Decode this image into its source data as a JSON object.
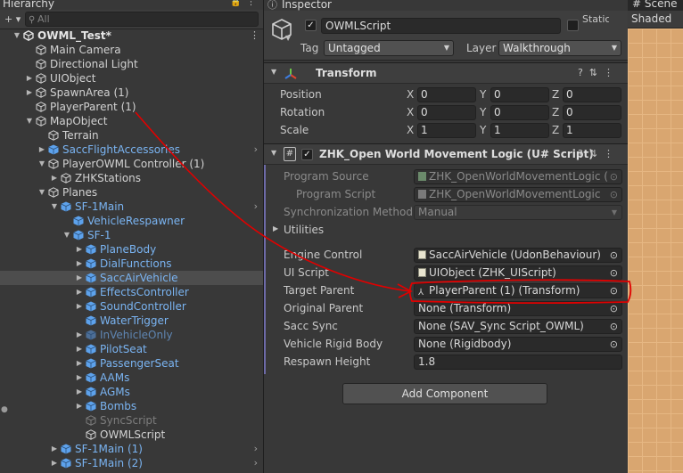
{
  "hierarchy": {
    "tab_label": "Hierarchy",
    "search_placeholder": "All",
    "side_glyph": "●",
    "rows": [
      {
        "label": "OWML_Test*",
        "depth": 0,
        "fold": "open",
        "icon": "unity-scene-icon",
        "style": "scene"
      },
      {
        "label": "Main Camera",
        "depth": 1,
        "fold": "none",
        "icon": "cube-outline-icon",
        "style": "normal"
      },
      {
        "label": "Directional Light",
        "depth": 1,
        "fold": "none",
        "icon": "cube-outline-icon",
        "style": "normal"
      },
      {
        "label": "UIObject",
        "depth": 1,
        "fold": "closed",
        "icon": "cube-outline-icon",
        "style": "normal"
      },
      {
        "label": "SpawnArea (1)",
        "depth": 1,
        "fold": "closed",
        "icon": "cube-outline-icon",
        "style": "normal"
      },
      {
        "label": "PlayerParent (1)",
        "depth": 1,
        "fold": "none",
        "icon": "cube-outline-icon",
        "style": "normal"
      },
      {
        "label": "MapObject",
        "depth": 1,
        "fold": "open",
        "icon": "cube-outline-icon",
        "style": "normal"
      },
      {
        "label": "Terrain",
        "depth": 2,
        "fold": "none",
        "icon": "cube-outline-icon",
        "style": "normal"
      },
      {
        "label": "SaccFlightAccessories",
        "depth": 2,
        "fold": "closed",
        "icon": "prefab-icon",
        "style": "prefab",
        "arrow": true
      },
      {
        "label": "PlayerOWML Controller (1)",
        "depth": 2,
        "fold": "open",
        "icon": "cube-outline-icon",
        "style": "normal"
      },
      {
        "label": "ZHKStations",
        "depth": 3,
        "fold": "closed",
        "icon": "cube-outline-icon",
        "style": "normal"
      },
      {
        "label": "Planes",
        "depth": 2,
        "fold": "open",
        "icon": "cube-outline-icon",
        "style": "normal"
      },
      {
        "label": "SF-1Main",
        "depth": 3,
        "fold": "open",
        "icon": "prefab-icon",
        "style": "prefab",
        "arrow": true
      },
      {
        "label": "VehicleRespawner",
        "depth": 4,
        "fold": "none",
        "icon": "prefab-icon",
        "style": "prefab"
      },
      {
        "label": "SF-1",
        "depth": 4,
        "fold": "open",
        "icon": "prefab-icon",
        "style": "prefab"
      },
      {
        "label": "PlaneBody",
        "depth": 5,
        "fold": "closed",
        "icon": "prefab-icon",
        "style": "prefab"
      },
      {
        "label": "DialFunctions",
        "depth": 5,
        "fold": "closed",
        "icon": "prefab-icon",
        "style": "prefab"
      },
      {
        "label": "SaccAirVehicle",
        "depth": 5,
        "fold": "closed",
        "icon": "prefab-icon",
        "style": "prefab",
        "selected": true
      },
      {
        "label": "EffectsController",
        "depth": 5,
        "fold": "closed",
        "icon": "prefab-icon",
        "style": "prefab"
      },
      {
        "label": "SoundController",
        "depth": 5,
        "fold": "closed",
        "icon": "prefab-icon",
        "style": "prefab"
      },
      {
        "label": "WaterTrigger",
        "depth": 5,
        "fold": "none",
        "icon": "prefab-icon",
        "style": "prefab"
      },
      {
        "label": "InVehicleOnly",
        "depth": 5,
        "fold": "closed",
        "icon": "prefab-icon",
        "style": "prefab-dis"
      },
      {
        "label": "PilotSeat",
        "depth": 5,
        "fold": "closed",
        "icon": "prefab-icon",
        "style": "prefab"
      },
      {
        "label": "PassengerSeat",
        "depth": 5,
        "fold": "closed",
        "icon": "prefab-icon",
        "style": "prefab"
      },
      {
        "label": "AAMs",
        "depth": 5,
        "fold": "closed",
        "icon": "prefab-icon",
        "style": "prefab"
      },
      {
        "label": "AGMs",
        "depth": 5,
        "fold": "closed",
        "icon": "prefab-icon",
        "style": "prefab"
      },
      {
        "label": "Bombs",
        "depth": 5,
        "fold": "closed",
        "icon": "prefab-icon",
        "style": "prefab"
      },
      {
        "label": "SyncScript",
        "depth": 5,
        "fold": "none",
        "icon": "cube-outline-icon",
        "style": "disabled"
      },
      {
        "label": "OWMLScript",
        "depth": 5,
        "fold": "none",
        "icon": "cube-outline-icon",
        "style": "normal"
      },
      {
        "label": "SF-1Main (1)",
        "depth": 3,
        "fold": "closed",
        "icon": "prefab-icon",
        "style": "prefab",
        "arrow": true
      },
      {
        "label": "SF-1Main (2)",
        "depth": 3,
        "fold": "closed",
        "icon": "prefab-icon",
        "style": "prefab",
        "arrow": true
      }
    ]
  },
  "inspector": {
    "tab_label": "Inspector",
    "object_name": "OWMLScript",
    "static_label": "Static",
    "tag_label": "Tag",
    "tag_value": "Untagged",
    "layer_label": "Layer",
    "layer_value": "Walkthrough",
    "transform": {
      "title": "Transform",
      "rows": [
        {
          "label": "Position",
          "x": "0",
          "y": "0",
          "z": "0"
        },
        {
          "label": "Rotation",
          "x": "0",
          "y": "0",
          "z": "0"
        },
        {
          "label": "Scale",
          "x": "1",
          "y": "1",
          "z": "1"
        }
      ]
    },
    "script": {
      "title": "ZHK_Open World Movement Logic (U# Script)",
      "program_source_label": "Program Source",
      "program_source_value": "ZHK_OpenWorldMovementLogic (U",
      "program_script_label": "Program Script",
      "program_script_value": "ZHK_OpenWorldMovementLogic",
      "sync_method_label": "Synchronization Method",
      "sync_method_value": "Manual",
      "utilities_label": "Utilities",
      "fields": [
        {
          "label": "Engine Control",
          "value": "SaccAirVehicle (UdonBehaviour)",
          "icon": "script-icon"
        },
        {
          "label": "UI Script",
          "value": "UIObject (ZHK_UIScript)",
          "icon": "script-icon"
        },
        {
          "label": "Target Parent",
          "value": "PlayerParent (1) (Transform)",
          "icon": "transform-icon"
        },
        {
          "label": "Original Parent",
          "value": "None (Transform)",
          "icon": ""
        },
        {
          "label": "Sacc Sync",
          "value": "None (SAV_Sync Script_OWML)",
          "icon": ""
        },
        {
          "label": "Vehicle Rigid Body",
          "value": "None (Rigidbody)",
          "icon": ""
        }
      ],
      "respawn_label": "Respawn Height",
      "respawn_value": "1.8"
    },
    "add_component": "Add Component"
  },
  "scene": {
    "tab_label": "Scene",
    "shading": "Shaded"
  },
  "axes": {
    "x": "X",
    "y": "Y",
    "z": "Z"
  },
  "colors": {
    "annotation": "#e00000",
    "prefab_text": "#7ab4f2",
    "selection": "#4d4d4d"
  }
}
